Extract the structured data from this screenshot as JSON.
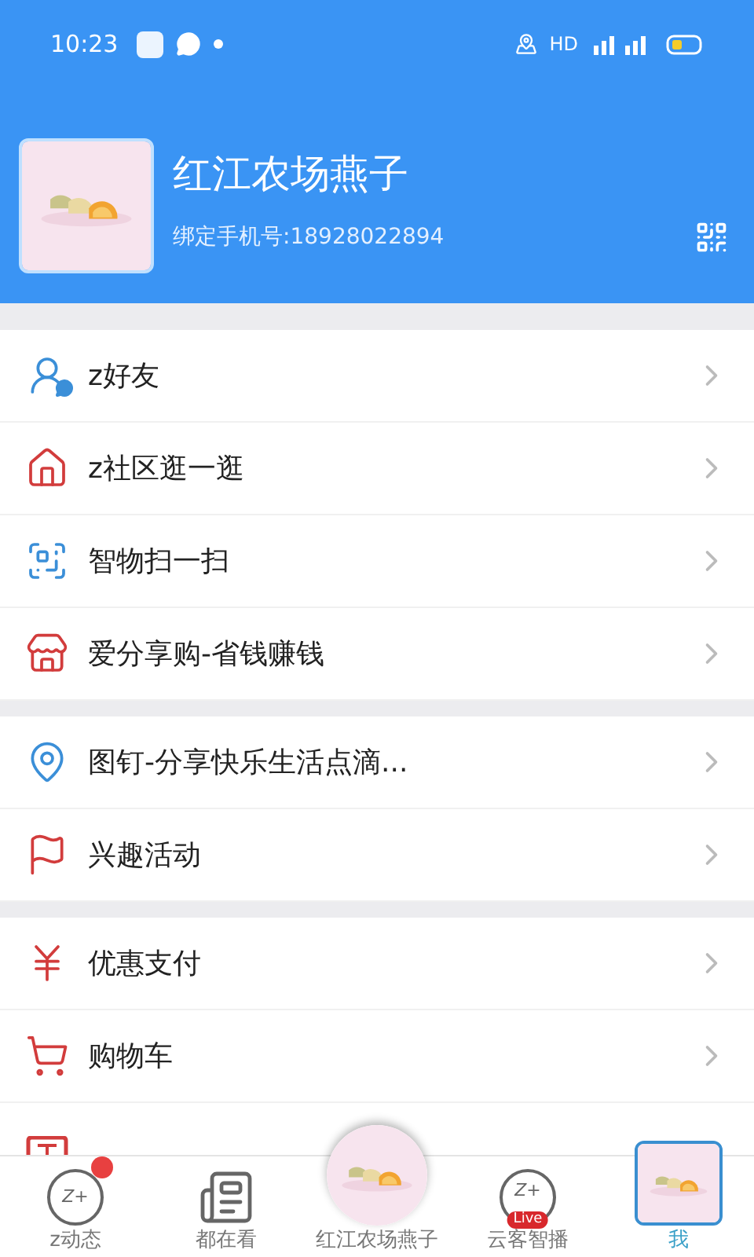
{
  "status_bar": {
    "time": "10:23",
    "network": "HD"
  },
  "profile": {
    "name": "红江农场燕子",
    "phone": "绑定手机号:18928022894"
  },
  "sections": [
    {
      "items": [
        {
          "label": "z好友",
          "kind": "friends"
        },
        {
          "label": "z社区逛一逛",
          "kind": "community"
        },
        {
          "label": "智物扫一扫",
          "kind": "scan"
        },
        {
          "label": "爱分享购-省钱赚钱",
          "kind": "store"
        }
      ]
    },
    {
      "items": [
        {
          "label": "图钉-分享快乐生活点滴...",
          "kind": "pin"
        },
        {
          "label": "兴趣活动",
          "kind": "flag"
        }
      ]
    },
    {
      "items": [
        {
          "label": "优惠支付",
          "kind": "pay"
        },
        {
          "label": "购物车",
          "kind": "cart"
        },
        {
          "kind": "wallet"
        }
      ]
    }
  ],
  "tabs": [
    {
      "label": "z动态",
      "kind": "chat",
      "icon_text": "Z+",
      "badge": true,
      "selected": false
    },
    {
      "label": "都在看",
      "kind": "news",
      "badge": false,
      "selected": false
    },
    {
      "label": "红江农场燕子",
      "kind": "center",
      "badge": false,
      "selected": false
    },
    {
      "label": "云客智播",
      "kind": "live",
      "icon_text": "Z+",
      "live_text": "Live",
      "badge": false,
      "selected": false
    },
    {
      "label": "我",
      "kind": "avatar",
      "badge": false,
      "selected": true
    }
  ]
}
